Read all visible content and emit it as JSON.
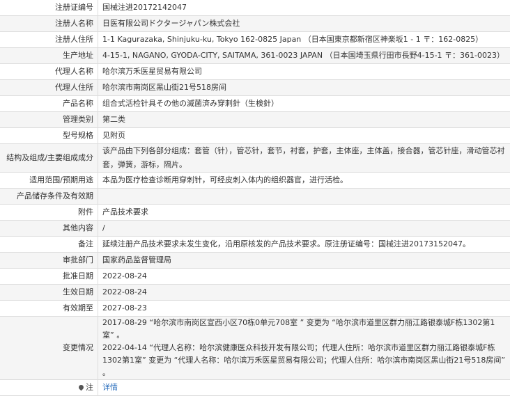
{
  "rows": [
    {
      "label": "注册证编号",
      "value": "国械注进20172142047"
    },
    {
      "label": "注册人名称",
      "value": "日医有限公司ドクタージャパン株式会社"
    },
    {
      "label": "注册人住所",
      "value": "1-1 Kagurazaka, Shinjuku-ku, Tokyo 162-0825 Japan （日本国東京都新宿区神楽坂1 - 1 〒：162-0825）"
    },
    {
      "label": "生产地址",
      "value": "4-15-1, NAGANO, GYODA-CITY, SAITAMA, 361-0023 JAPAN （日本国埼玉県行田市長野4-15-1 〒：361-0023）"
    },
    {
      "label": "代理人名称",
      "value": "哈尔滨万禾医星贸易有限公司"
    },
    {
      "label": "代理人住所",
      "value": "哈尔滨市南岗区黑山街21号518房间"
    },
    {
      "label": "产品名称",
      "value": "组合式活检针具その他の滅菌済み穿刺針（生検針）"
    },
    {
      "label": "管理类别",
      "value": "第二类"
    },
    {
      "label": "型号规格",
      "value": "见附页"
    },
    {
      "label": "结构及组成/主要组成成分",
      "value": "该产品由下列各部分组成：套管（针），管芯针，套节，衬套，护套，主体座，主体盖，接合器，管芯针座，滑动管芯衬套，弹簧，游标，隔片。"
    },
    {
      "label": "适用范围/预期用途",
      "value": "本品为医疗检查诊断用穿刺针，可经皮刺入体内的组织器官，进行活检。"
    },
    {
      "label": "产品储存条件及有效期",
      "value": ""
    },
    {
      "label": "附件",
      "value": "产品技术要求"
    },
    {
      "label": "其他内容",
      "value": "/"
    },
    {
      "label": "备注",
      "value": "延续注册产品技术要求未发生变化，沿用原核发的产品技术要求。原注册证编号：国械注进20173152047。"
    },
    {
      "label": "审批部门",
      "value": "国家药品监督管理局"
    },
    {
      "label": "批准日期",
      "value": "2022-08-24"
    },
    {
      "label": "生效日期",
      "value": "2022-08-24"
    },
    {
      "label": "有效期至",
      "value": "2027-08-23"
    }
  ],
  "changes": {
    "label": "变更情况",
    "line1": "2017-08-29 “哈尔滨市南岗区宣西小区70栋0单元708室 ” 变更为 “哈尔滨市道里区群力丽江路银泰城F栋1302第1室” 。",
    "line2": "2022-04-14 “代理人名称：哈尔滨健康医众科技开发有限公司；代理人住所：哈尔滨市道里区群力丽江路银泰城F栋1302第1室” 变更为 “代理人名称：哈尔滨万禾医星贸易有限公司；代理人住所：哈尔滨市南岗区黑山街21号518房间” 。"
  },
  "note": {
    "label": "注",
    "link": "详情",
    "icon": "map-pin-icon"
  }
}
